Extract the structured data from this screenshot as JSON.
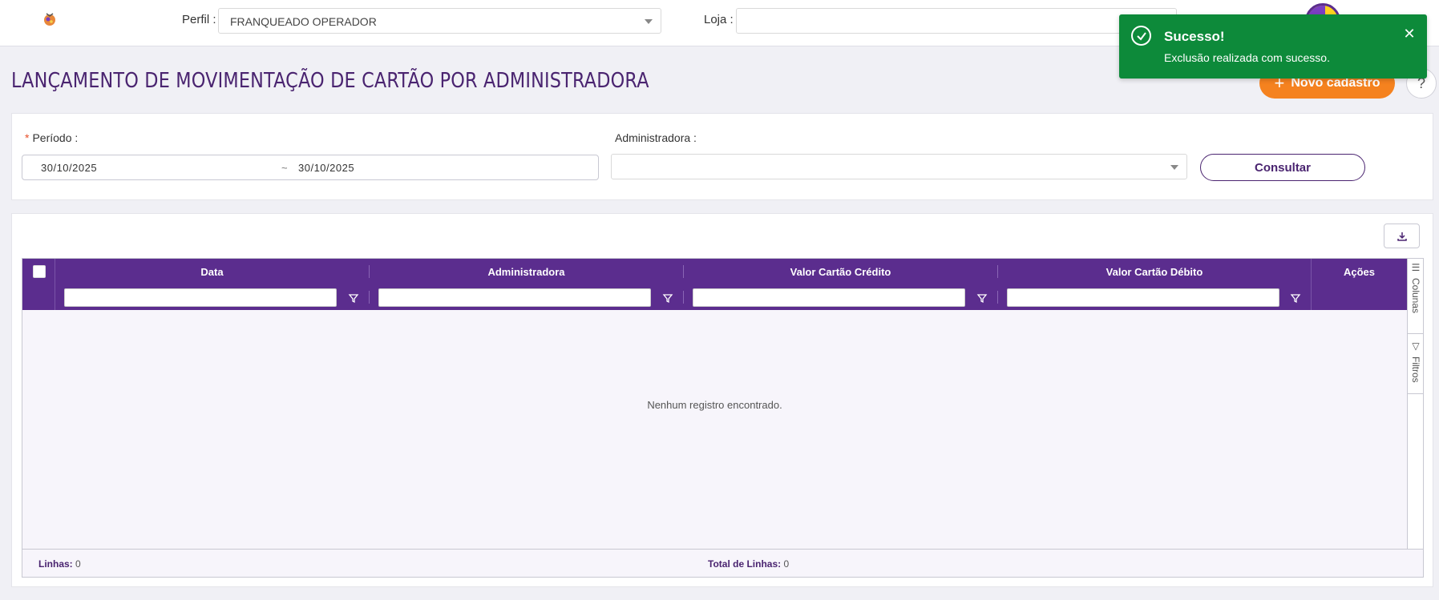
{
  "header": {
    "perfil_label": "Perfil",
    "perfil_value": "FRANQUEADO OPERADOR",
    "loja_label": "Loja",
    "loja_value": ""
  },
  "page": {
    "title": "LANÇAMENTO DE MOVIMENTAÇÃO DE CARTÃO POR ADMINISTRADORA",
    "new_button": "Novo cadastro",
    "help_button": "?"
  },
  "filters": {
    "periodo_label": "Período",
    "periodo_start": "30/10/2025",
    "periodo_separator": "~",
    "periodo_end": "30/10/2025",
    "administradora_label": "Administradora",
    "administradora_value": "",
    "consultar_button": "Consultar"
  },
  "grid": {
    "columns": [
      "Data",
      "Administradora",
      "Valor Cartão Crédito",
      "Valor Cartão Débito",
      "Ações"
    ],
    "empty_message": "Nenhum registro encontrado.",
    "footer": {
      "linhas_label": "Linhas:",
      "linhas_value": "0",
      "total_label": "Total de Linhas:",
      "total_value": "0"
    },
    "side_tabs": [
      "Colunas",
      "Filtros"
    ]
  },
  "toast": {
    "title": "Sucesso!",
    "message": "Exclusão realizada com sucesso.",
    "color": "#0d8a3a"
  },
  "colors": {
    "brand_purple": "#5b2d8e",
    "accent_orange": "#f5821f"
  }
}
